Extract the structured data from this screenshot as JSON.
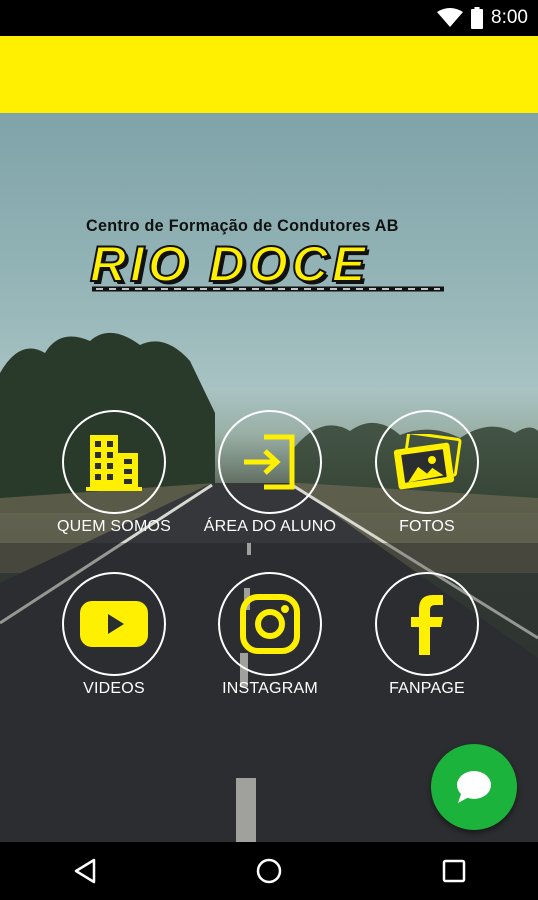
{
  "status_bar": {
    "time": "8:00",
    "icons": [
      "wifi-icon",
      "battery-icon"
    ]
  },
  "app": {
    "header_color": "#ffef00",
    "accent_color": "#ffef00"
  },
  "logo": {
    "subtitle": "Centro de Formação de Condutores AB",
    "title": "RIO DOCE"
  },
  "menu": {
    "quem_somos": {
      "label": "QUEM SOMOS",
      "icon": "building-icon"
    },
    "area_aluno": {
      "label": "ÁREA DO ALUNO",
      "icon": "login-icon"
    },
    "fotos": {
      "label": "FOTOS",
      "icon": "photos-icon"
    },
    "videos": {
      "label": "VIDEOS",
      "icon": "youtube-icon"
    },
    "instagram": {
      "label": "INSTAGRAM",
      "icon": "instagram-icon"
    },
    "fanpage": {
      "label": "FANPAGE",
      "icon": "facebook-icon"
    }
  },
  "fab": {
    "icon": "chat-icon",
    "color": "#1bb33b"
  },
  "nav_bar": {
    "icons": [
      "back-icon",
      "home-icon",
      "recents-icon"
    ]
  }
}
